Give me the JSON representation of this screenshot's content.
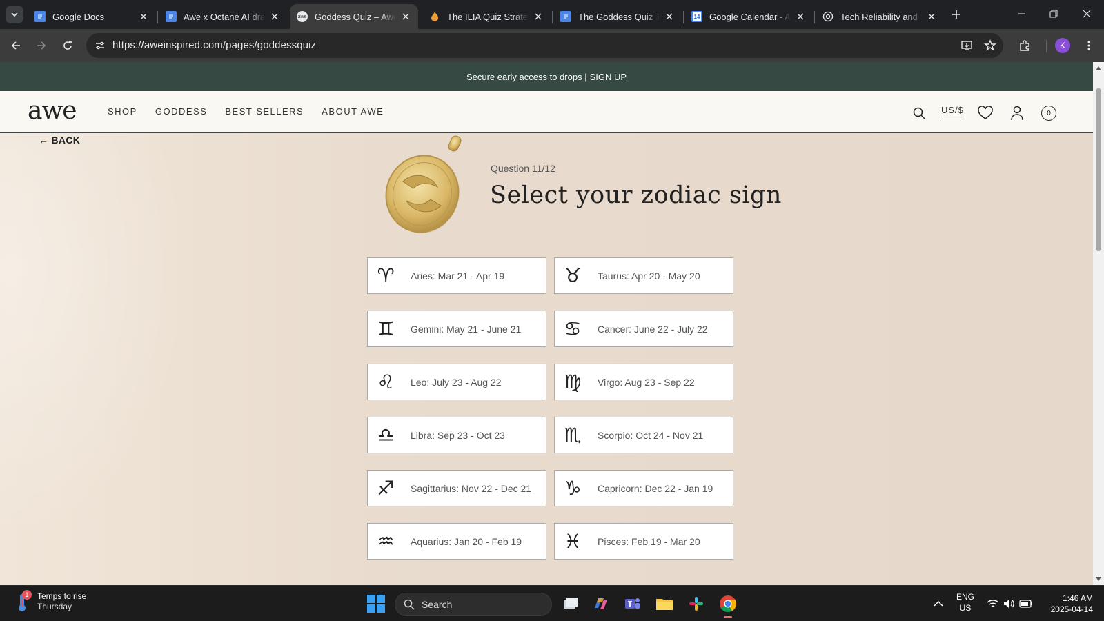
{
  "browser": {
    "tabs": [
      {
        "title": "Google Docs",
        "favicon": "docs-icon",
        "active": false
      },
      {
        "title": "Awe x Octane AI draft",
        "favicon": "docs-icon",
        "active": false
      },
      {
        "title": "Goddess Quiz – Awe Inspired",
        "favicon": "awe-icon",
        "active": true
      },
      {
        "title": "The ILIA Quiz Strategy",
        "favicon": "fire-icon",
        "active": false
      },
      {
        "title": "The Goddess Quiz The",
        "favicon": "docs-icon",
        "active": false
      },
      {
        "title": "Google Calendar - April",
        "favicon": "calendar-icon",
        "active": false
      },
      {
        "title": "Tech Reliability and S",
        "favicon": "openai-icon",
        "active": false
      }
    ],
    "url": "https://aweinspired.com/pages/goddessquiz",
    "profile_initial": "K"
  },
  "announcement": {
    "text": "Secure early access to drops |",
    "link": "SIGN UP"
  },
  "site": {
    "logo": "awe",
    "nav": [
      "SHOP",
      "GODDESS",
      "BEST SELLERS",
      "ABOUT AWE"
    ],
    "currency": "US/$",
    "cart_count": "0"
  },
  "quiz": {
    "back": "← BACK",
    "question_number": "Question 11/12",
    "title": "Select your zodiac sign",
    "options": [
      {
        "label": "Aries: Mar 21 - Apr 19",
        "symbol": "♈"
      },
      {
        "label": "Taurus: Apr 20 - May 20",
        "symbol": "♉"
      },
      {
        "label": "Gemini: May 21 - June 21",
        "symbol": "♊"
      },
      {
        "label": "Cancer: June 22 - July 22",
        "symbol": "♋"
      },
      {
        "label": "Leo: July 23 - Aug 22",
        "symbol": "♌"
      },
      {
        "label": "Virgo: Aug 23 - Sep 22",
        "symbol": "♍"
      },
      {
        "label": "Libra: Sep 23 - Oct 23",
        "symbol": "♎"
      },
      {
        "label": "Scorpio: Oct 24 - Nov 21",
        "symbol": "♏"
      },
      {
        "label": "Sagittarius: Nov 22 - Dec 21",
        "symbol": "♐"
      },
      {
        "label": "Capricorn: Dec 22 - Jan 19",
        "symbol": "♑"
      },
      {
        "label": "Aquarius: Jan 20 - Feb 19",
        "symbol": "♒"
      },
      {
        "label": "Pisces: Feb 19 - Mar 20",
        "symbol": "♓"
      }
    ]
  },
  "taskbar": {
    "weather_title": "Temps to rise",
    "weather_sub": "Thursday",
    "weather_badge": "1",
    "search_placeholder": "Search",
    "lang_top": "ENG",
    "lang_bottom": "US",
    "time": "1:46 AM",
    "date": "2025-04-14"
  },
  "colors": {
    "announcement_bg": "#364942",
    "page_bg": "#e8dbcd",
    "header_bg": "#faf8f3"
  }
}
